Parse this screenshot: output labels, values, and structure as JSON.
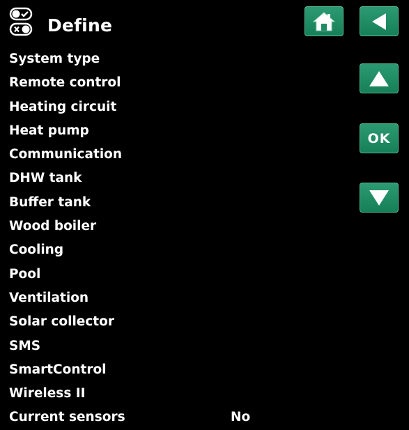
{
  "header": {
    "title": "Define",
    "icons": {
      "define": "toggle-switches-icon",
      "home": "home-icon",
      "back": "back-arrow-icon"
    }
  },
  "nav": {
    "up_icon": "up-arrow-icon",
    "ok_label": "OK",
    "down_icon": "down-arrow-icon"
  },
  "menu": {
    "items": [
      {
        "label": "System type",
        "value": ""
      },
      {
        "label": "Remote control",
        "value": ""
      },
      {
        "label": "Heating circuit",
        "value": ""
      },
      {
        "label": "Heat pump",
        "value": ""
      },
      {
        "label": "Communication",
        "value": ""
      },
      {
        "label": "DHW tank",
        "value": ""
      },
      {
        "label": "Buffer tank",
        "value": ""
      },
      {
        "label": "Wood boiler",
        "value": ""
      },
      {
        "label": "Cooling",
        "value": ""
      },
      {
        "label": "Pool",
        "value": ""
      },
      {
        "label": "Ventilation",
        "value": ""
      },
      {
        "label": "Solar collector",
        "value": ""
      },
      {
        "label": "SMS",
        "value": ""
      },
      {
        "label": "SmartControl",
        "value": ""
      },
      {
        "label": "Wireless II",
        "value": ""
      },
      {
        "label": "Current sensors",
        "value": "No"
      }
    ]
  },
  "colors": {
    "background": "#000000",
    "button": "#1f8c64",
    "text": "#ffffff"
  }
}
